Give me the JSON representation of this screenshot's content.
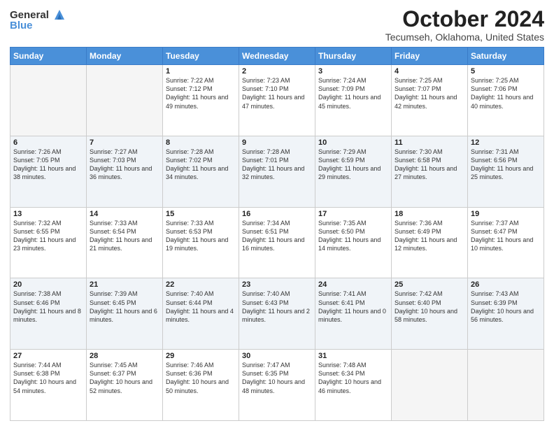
{
  "logo": {
    "general": "General",
    "blue": "Blue"
  },
  "header": {
    "month": "October 2024",
    "location": "Tecumseh, Oklahoma, United States"
  },
  "weekdays": [
    "Sunday",
    "Monday",
    "Tuesday",
    "Wednesday",
    "Thursday",
    "Friday",
    "Saturday"
  ],
  "weeks": [
    [
      {
        "day": "",
        "sunrise": "",
        "sunset": "",
        "daylight": ""
      },
      {
        "day": "",
        "sunrise": "",
        "sunset": "",
        "daylight": ""
      },
      {
        "day": "1",
        "sunrise": "Sunrise: 7:22 AM",
        "sunset": "Sunset: 7:12 PM",
        "daylight": "Daylight: 11 hours and 49 minutes."
      },
      {
        "day": "2",
        "sunrise": "Sunrise: 7:23 AM",
        "sunset": "Sunset: 7:10 PM",
        "daylight": "Daylight: 11 hours and 47 minutes."
      },
      {
        "day": "3",
        "sunrise": "Sunrise: 7:24 AM",
        "sunset": "Sunset: 7:09 PM",
        "daylight": "Daylight: 11 hours and 45 minutes."
      },
      {
        "day": "4",
        "sunrise": "Sunrise: 7:25 AM",
        "sunset": "Sunset: 7:07 PM",
        "daylight": "Daylight: 11 hours and 42 minutes."
      },
      {
        "day": "5",
        "sunrise": "Sunrise: 7:25 AM",
        "sunset": "Sunset: 7:06 PM",
        "daylight": "Daylight: 11 hours and 40 minutes."
      }
    ],
    [
      {
        "day": "6",
        "sunrise": "Sunrise: 7:26 AM",
        "sunset": "Sunset: 7:05 PM",
        "daylight": "Daylight: 11 hours and 38 minutes."
      },
      {
        "day": "7",
        "sunrise": "Sunrise: 7:27 AM",
        "sunset": "Sunset: 7:03 PM",
        "daylight": "Daylight: 11 hours and 36 minutes."
      },
      {
        "day": "8",
        "sunrise": "Sunrise: 7:28 AM",
        "sunset": "Sunset: 7:02 PM",
        "daylight": "Daylight: 11 hours and 34 minutes."
      },
      {
        "day": "9",
        "sunrise": "Sunrise: 7:28 AM",
        "sunset": "Sunset: 7:01 PM",
        "daylight": "Daylight: 11 hours and 32 minutes."
      },
      {
        "day": "10",
        "sunrise": "Sunrise: 7:29 AM",
        "sunset": "Sunset: 6:59 PM",
        "daylight": "Daylight: 11 hours and 29 minutes."
      },
      {
        "day": "11",
        "sunrise": "Sunrise: 7:30 AM",
        "sunset": "Sunset: 6:58 PM",
        "daylight": "Daylight: 11 hours and 27 minutes."
      },
      {
        "day": "12",
        "sunrise": "Sunrise: 7:31 AM",
        "sunset": "Sunset: 6:56 PM",
        "daylight": "Daylight: 11 hours and 25 minutes."
      }
    ],
    [
      {
        "day": "13",
        "sunrise": "Sunrise: 7:32 AM",
        "sunset": "Sunset: 6:55 PM",
        "daylight": "Daylight: 11 hours and 23 minutes."
      },
      {
        "day": "14",
        "sunrise": "Sunrise: 7:33 AM",
        "sunset": "Sunset: 6:54 PM",
        "daylight": "Daylight: 11 hours and 21 minutes."
      },
      {
        "day": "15",
        "sunrise": "Sunrise: 7:33 AM",
        "sunset": "Sunset: 6:53 PM",
        "daylight": "Daylight: 11 hours and 19 minutes."
      },
      {
        "day": "16",
        "sunrise": "Sunrise: 7:34 AM",
        "sunset": "Sunset: 6:51 PM",
        "daylight": "Daylight: 11 hours and 16 minutes."
      },
      {
        "day": "17",
        "sunrise": "Sunrise: 7:35 AM",
        "sunset": "Sunset: 6:50 PM",
        "daylight": "Daylight: 11 hours and 14 minutes."
      },
      {
        "day": "18",
        "sunrise": "Sunrise: 7:36 AM",
        "sunset": "Sunset: 6:49 PM",
        "daylight": "Daylight: 11 hours and 12 minutes."
      },
      {
        "day": "19",
        "sunrise": "Sunrise: 7:37 AM",
        "sunset": "Sunset: 6:47 PM",
        "daylight": "Daylight: 11 hours and 10 minutes."
      }
    ],
    [
      {
        "day": "20",
        "sunrise": "Sunrise: 7:38 AM",
        "sunset": "Sunset: 6:46 PM",
        "daylight": "Daylight: 11 hours and 8 minutes."
      },
      {
        "day": "21",
        "sunrise": "Sunrise: 7:39 AM",
        "sunset": "Sunset: 6:45 PM",
        "daylight": "Daylight: 11 hours and 6 minutes."
      },
      {
        "day": "22",
        "sunrise": "Sunrise: 7:40 AM",
        "sunset": "Sunset: 6:44 PM",
        "daylight": "Daylight: 11 hours and 4 minutes."
      },
      {
        "day": "23",
        "sunrise": "Sunrise: 7:40 AM",
        "sunset": "Sunset: 6:43 PM",
        "daylight": "Daylight: 11 hours and 2 minutes."
      },
      {
        "day": "24",
        "sunrise": "Sunrise: 7:41 AM",
        "sunset": "Sunset: 6:41 PM",
        "daylight": "Daylight: 11 hours and 0 minutes."
      },
      {
        "day": "25",
        "sunrise": "Sunrise: 7:42 AM",
        "sunset": "Sunset: 6:40 PM",
        "daylight": "Daylight: 10 hours and 58 minutes."
      },
      {
        "day": "26",
        "sunrise": "Sunrise: 7:43 AM",
        "sunset": "Sunset: 6:39 PM",
        "daylight": "Daylight: 10 hours and 56 minutes."
      }
    ],
    [
      {
        "day": "27",
        "sunrise": "Sunrise: 7:44 AM",
        "sunset": "Sunset: 6:38 PM",
        "daylight": "Daylight: 10 hours and 54 minutes."
      },
      {
        "day": "28",
        "sunrise": "Sunrise: 7:45 AM",
        "sunset": "Sunset: 6:37 PM",
        "daylight": "Daylight: 10 hours and 52 minutes."
      },
      {
        "day": "29",
        "sunrise": "Sunrise: 7:46 AM",
        "sunset": "Sunset: 6:36 PM",
        "daylight": "Daylight: 10 hours and 50 minutes."
      },
      {
        "day": "30",
        "sunrise": "Sunrise: 7:47 AM",
        "sunset": "Sunset: 6:35 PM",
        "daylight": "Daylight: 10 hours and 48 minutes."
      },
      {
        "day": "31",
        "sunrise": "Sunrise: 7:48 AM",
        "sunset": "Sunset: 6:34 PM",
        "daylight": "Daylight: 10 hours and 46 minutes."
      },
      {
        "day": "",
        "sunrise": "",
        "sunset": "",
        "daylight": ""
      },
      {
        "day": "",
        "sunrise": "",
        "sunset": "",
        "daylight": ""
      }
    ]
  ]
}
